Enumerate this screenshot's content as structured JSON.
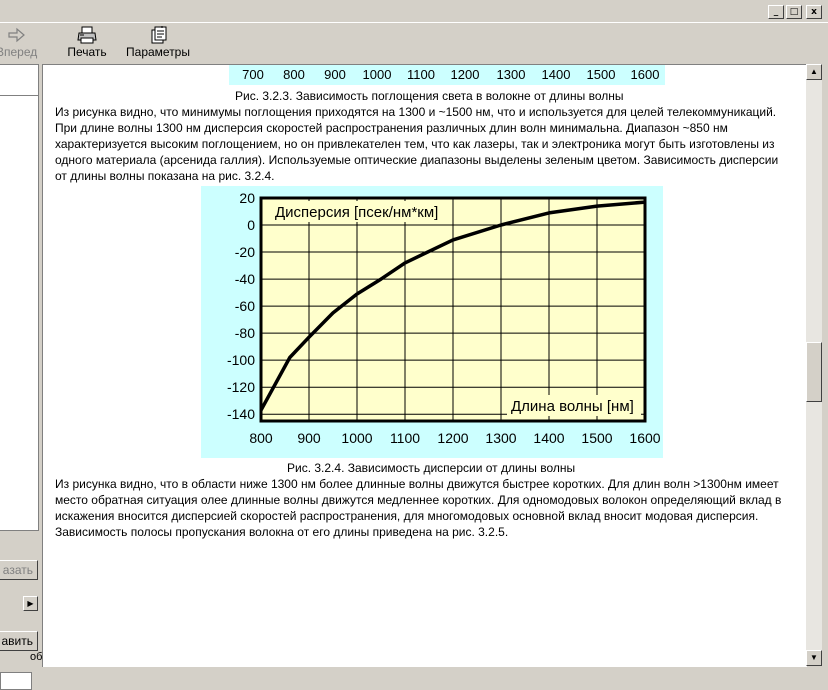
{
  "window": {
    "buttons": [
      "_",
      "□",
      "x"
    ]
  },
  "toolbar": {
    "forward_label": "Вперед",
    "print_label": "Печать",
    "params_label": "Параметры",
    "forward_icon": "arrow-right-icon",
    "print_icon": "printer-icon",
    "params_icon": "options-icon"
  },
  "left_pane": {
    "show_button_label": "азать",
    "hint_text": "об",
    "add_button_label": "авить"
  },
  "content": {
    "top_axis_ticks": [
      "700",
      "800",
      "900",
      "1000",
      "1100",
      "1200",
      "1300",
      "1400",
      "1500",
      "1600"
    ],
    "caption_1": "Рис. 3.2.3. Зависимость поглощения света в волокне от длины волны",
    "paragraph_1": [
      "Из рисунка видно, что минимумы поглощения приходятся на 1300 и ~1500 нм, что и используется для целей телекоммуникаций.",
      "При длине волны 1300 нм дисперсия скоростей распространения различных длин волн минимальна. Диапазон ~850 нм",
      "характеризуется высоким поглощением, но он привлекателен тем, что как лазеры, так и электроника могут быть изготовлены из",
      "одного материала (арсенида галлия). Используемые оптические диапазоны выделены зеленым цветом. Зависимость дисперсии",
      "от длины волны показана на рис. 3.2.4."
    ],
    "caption_2": "Рис. 3.2.4. Зависимость дисперсии от длины волны",
    "paragraph_2": [
      "Из рисунка видно, что в области ниже 1300 нм более длинные волны движутся быстрее коротких. Для длин волн >1300нм имеет",
      "место обратная ситуация олее длинные волны движутся медленнее коротких. Для одномодовых волокон определяющий вклад в",
      "искажения вносится дисперсией скоростей распространения, для многомодовых основной вклад вносит модовая дисперсия.",
      "Зависимость полосы пропускания волокна от его длины приведена на рис. 3.2.5."
    ]
  },
  "chart_data": {
    "type": "line",
    "ylabel": "Дисперсия [псек/нм*км]",
    "xlabel": "Длина волны [нм]",
    "xlim": [
      800,
      1600
    ],
    "ylim": [
      -145,
      20
    ],
    "x_ticks": [
      800,
      900,
      1000,
      1100,
      1200,
      1300,
      1400,
      1500,
      1600
    ],
    "y_ticks": [
      20,
      0,
      -20,
      -40,
      -60,
      -80,
      -100,
      -120,
      -140
    ],
    "grid": true,
    "x": [
      800,
      860,
      900,
      950,
      1000,
      1050,
      1100,
      1200,
      1300,
      1400,
      1500,
      1600
    ],
    "y": [
      -137,
      -98,
      -83,
      -65,
      -51,
      -40,
      -28,
      -11,
      0,
      9,
      14,
      17
    ],
    "colors": {
      "background": "#ccffff",
      "plot_area": "#ffffcc",
      "line": "#000000",
      "grid": "#000000"
    }
  }
}
